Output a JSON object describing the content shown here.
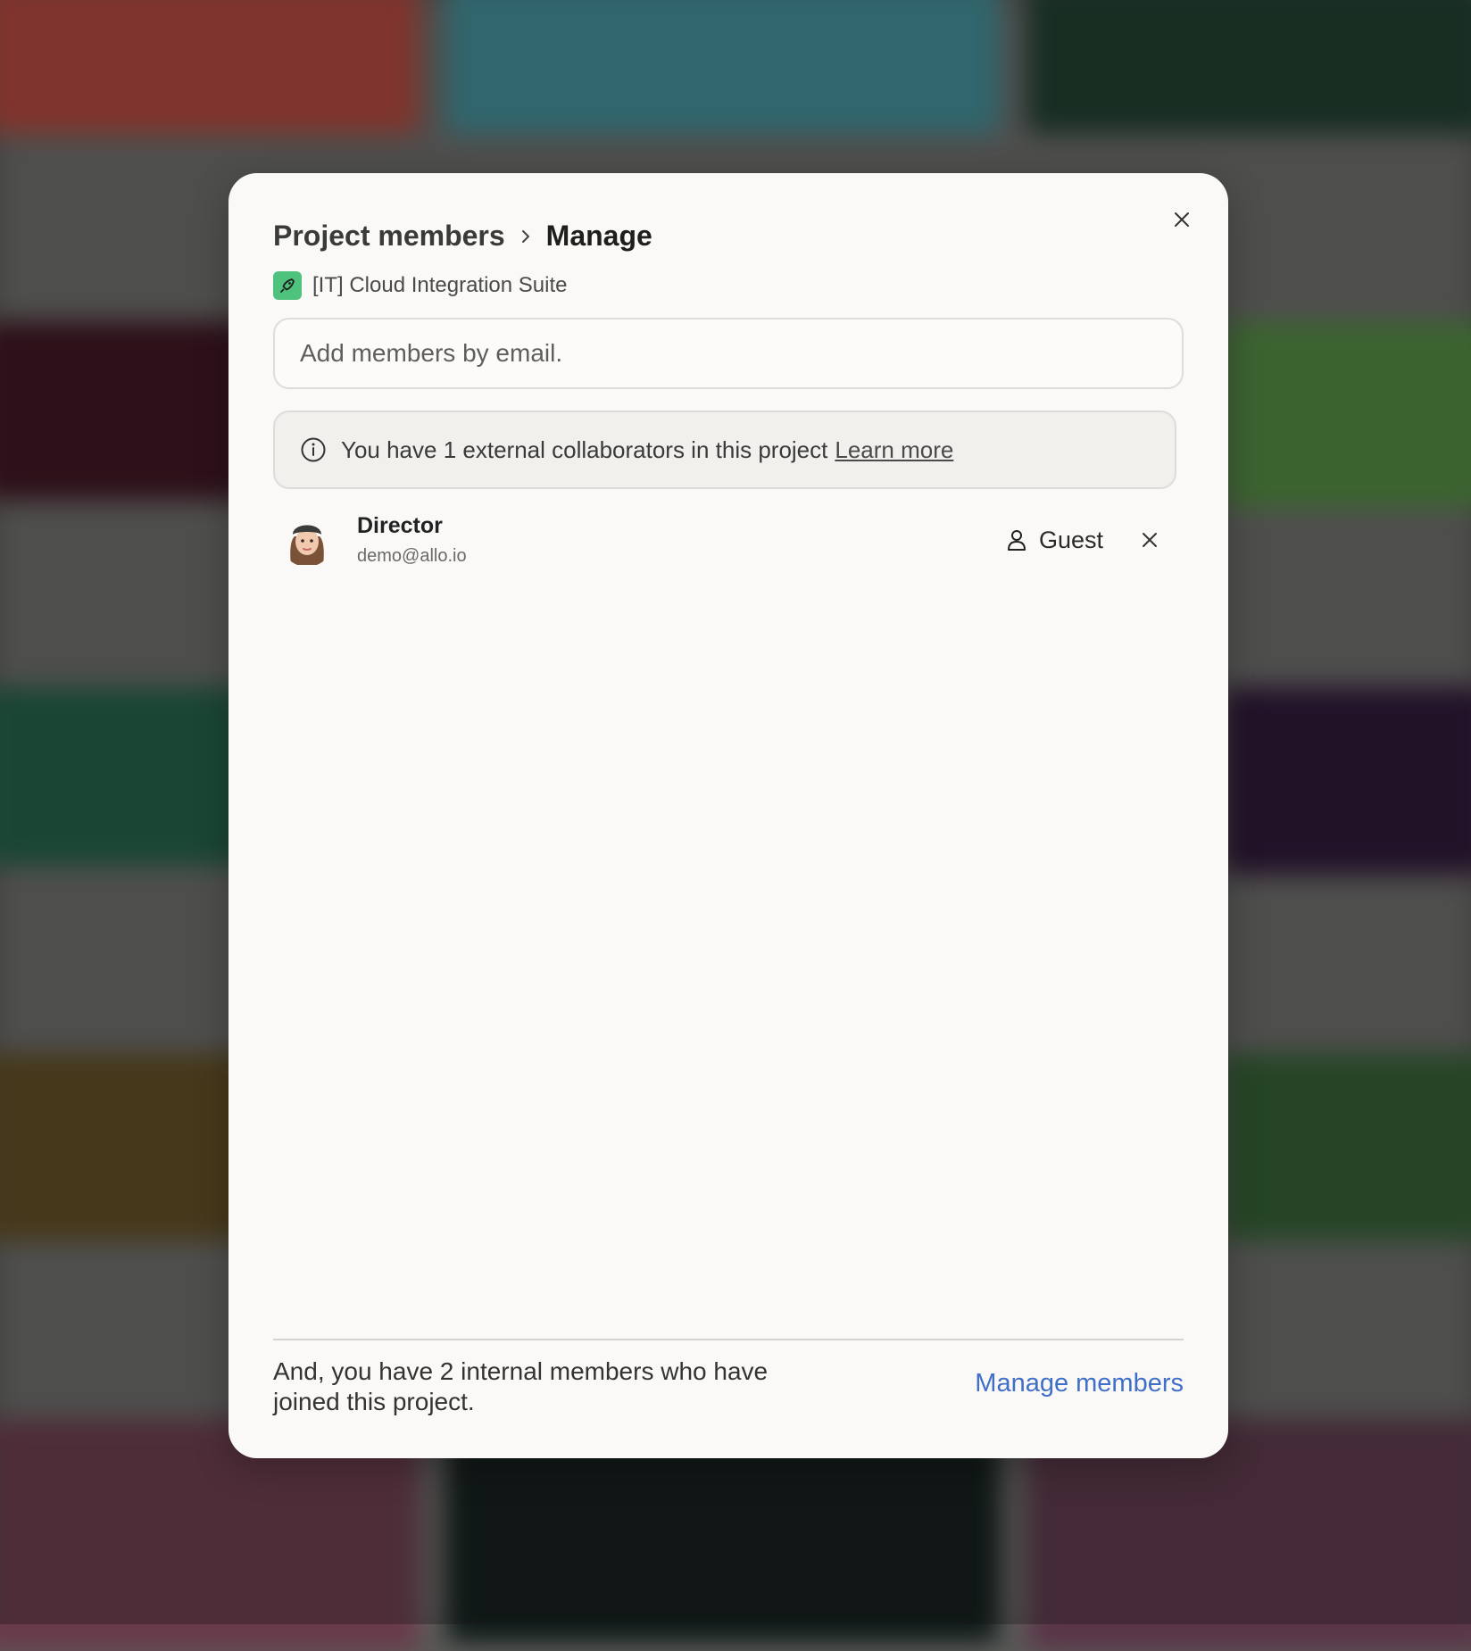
{
  "modal": {
    "breadcrumb_parent": "Project members",
    "breadcrumb_current": "Manage",
    "project_name": "[IT] Cloud Integration Suite",
    "email_placeholder": "Add members by email.",
    "notice_text": "You have 1 external collaborators in this project",
    "notice_link": "Learn more",
    "members": [
      {
        "name": "Director",
        "email": "demo@allo.io",
        "role": "Guest"
      }
    ],
    "footer_text": "And, you have 2 internal members who have joined this project.",
    "footer_link": "Manage members"
  },
  "icons": {
    "close": "close-icon",
    "chevron": "chevron-right-icon",
    "project": "rocket-icon",
    "info": "info-icon",
    "role": "person-icon",
    "remove": "close-icon"
  },
  "colors": {
    "project_icon_bg": "#4fc27d",
    "link": "#3f6fc9",
    "modal_bg": "#faf9f7"
  }
}
